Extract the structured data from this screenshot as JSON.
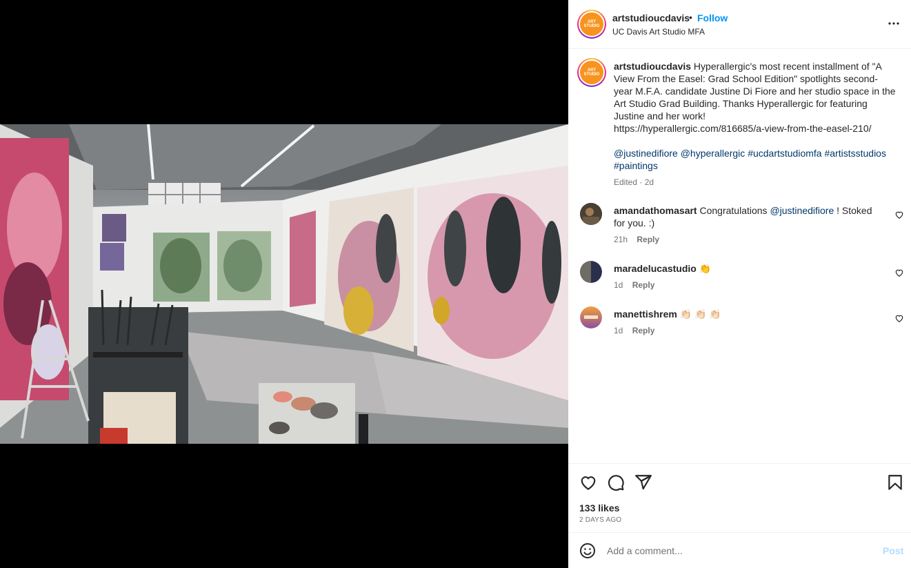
{
  "header": {
    "username": "artstudioucdavis",
    "separator": "•",
    "follow_label": "Follow",
    "subtitle": "UC Davis Art Studio MFA",
    "more_icon": "more-horizontal-icon"
  },
  "avatar_logo": {
    "line1": "ART",
    "line2": "STUDIO"
  },
  "caption": {
    "username": "artstudioucdavis",
    "body": "Hyperallergic's most recent installment of \"A View From the Easel: Grad School Edition\" spotlights second-year M.F.A. candidate Justine Di Fiore and her studio space in the Art Studio Grad Building. Thanks Hyperallergic for featuring Justine and her work!",
    "url": "https://hyperallergic.com/816685/a-view-from-the-easel-210/",
    "tag1": "@justinedifiore",
    "tag2": "@hyperallergic",
    "tag3": "#ucdartstudiomfa",
    "tag4": "#artistsstudios",
    "tag5": "#paintings",
    "meta": "Edited · 2d"
  },
  "comments": [
    {
      "username": "amandathomasart",
      "pre": "Congratulations",
      "mention": "@justinedifiore",
      "post": "! Stoked for you. :)",
      "time": "21h",
      "reply": "Reply"
    },
    {
      "username": "maradelucastudio",
      "text": "👏",
      "time": "1d",
      "reply": "Reply"
    },
    {
      "username": "manettishrem",
      "text": "👏🏻 👏🏻 👏🏻",
      "time": "1d",
      "reply": "Reply"
    }
  ],
  "actions": {
    "likes": "133 likes",
    "posted_ago": "2 DAYS AGO",
    "icons": [
      "heart-icon",
      "comment-icon",
      "share-icon",
      "bookmark-icon"
    ]
  },
  "add_comment": {
    "placeholder": "Add a comment...",
    "post_label": "Post"
  },
  "colors": {
    "link_blue": "#0095f6",
    "mention_blue": "#00376b",
    "muted": "#737373",
    "post_disabled": "#b3dbff",
    "logo_orange": "#f7931e"
  }
}
